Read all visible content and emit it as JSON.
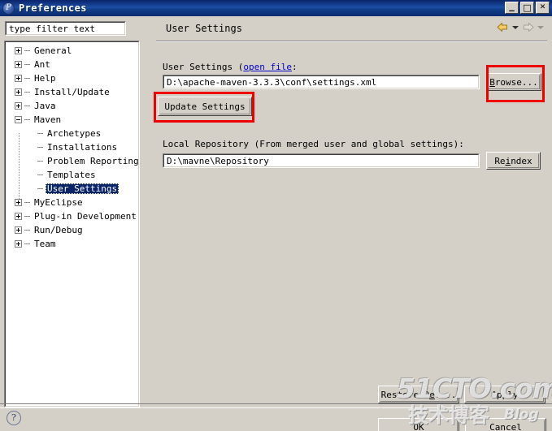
{
  "window": {
    "title": "Preferences",
    "icon": "preferences-icon",
    "controls": {
      "minimize": "_",
      "maximize": "□",
      "close": "✕"
    }
  },
  "sidebar": {
    "filter": {
      "value": "",
      "placeholder": "type filter text"
    },
    "tree": [
      {
        "label": "General",
        "level": 0,
        "expander": "plus",
        "selected": false
      },
      {
        "label": "Ant",
        "level": 0,
        "expander": "plus",
        "selected": false
      },
      {
        "label": "Help",
        "level": 0,
        "expander": "plus",
        "selected": false
      },
      {
        "label": "Install/Update",
        "level": 0,
        "expander": "plus",
        "selected": false
      },
      {
        "label": "Java",
        "level": 0,
        "expander": "plus",
        "selected": false
      },
      {
        "label": "Maven",
        "level": 0,
        "expander": "minus",
        "selected": false
      },
      {
        "label": "Archetypes",
        "level": 1,
        "expander": "none",
        "selected": false
      },
      {
        "label": "Installations",
        "level": 1,
        "expander": "none",
        "selected": false
      },
      {
        "label": "Problem Reporting",
        "level": 1,
        "expander": "none",
        "selected": false
      },
      {
        "label": "Templates",
        "level": 1,
        "expander": "none",
        "selected": false
      },
      {
        "label": "User Settings",
        "level": 1,
        "expander": "none",
        "selected": true
      },
      {
        "label": "MyEclipse",
        "level": 0,
        "expander": "plus",
        "selected": false
      },
      {
        "label": "Plug-in Development",
        "level": 0,
        "expander": "plus",
        "selected": false
      },
      {
        "label": "Run/Debug",
        "level": 0,
        "expander": "plus",
        "selected": false
      },
      {
        "label": "Team",
        "level": 0,
        "expander": "plus",
        "selected": false
      }
    ]
  },
  "main": {
    "page_title": "User Settings",
    "nav": {
      "back_icon": "back-arrow-icon",
      "back_dropdown_icon": "chevron-down-icon",
      "forward_icon": "forward-arrow-icon",
      "forward_dropdown_icon": "chevron-down-icon"
    },
    "user_settings": {
      "label_prefix": "User Settings",
      "link": "open file",
      "label_suffix": ":",
      "path_value": "D:\\apache-maven-3.3.3\\conf\\settings.xml",
      "browse_button": "Browse...",
      "update_button": "Update Settings"
    },
    "local_repository": {
      "label": "Local Repository (From merged user and global settings):",
      "path_value": "D:\\mavne\\Repository",
      "reindex_button": "Reindex"
    }
  },
  "footer": {
    "restore_defaults": "Restore Defaults",
    "apply": "Apply",
    "ok": "OK",
    "cancel": "Cancel",
    "help_icon": "help-question-icon",
    "help_glyph": "?"
  },
  "watermark": {
    "main": "51CTO.com",
    "chinese": "技术博客",
    "blog": "Blog"
  },
  "colors": {
    "titlebar_start": "#0a246a",
    "titlebar_end": "#1c4fa8",
    "dialog_bg": "#d4d0c8",
    "selection": "#0a246a",
    "link": "#0000cc",
    "annotation_red": "#ee0000"
  }
}
